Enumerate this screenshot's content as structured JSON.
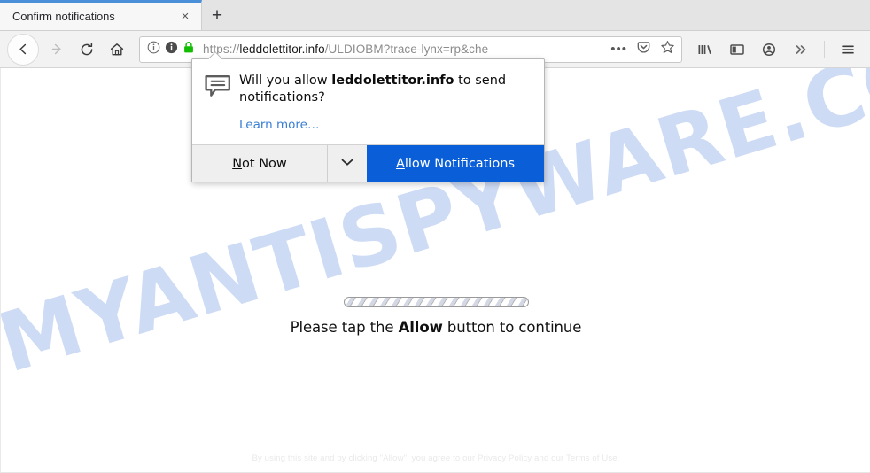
{
  "browser": {
    "tab": {
      "title": "Confirm notifications",
      "close_label": "×",
      "new_tab_label": "+"
    },
    "nav": {
      "back_label": "Back",
      "forward_label": "Forward",
      "reload_label": "Reload",
      "home_label": "Home"
    },
    "urlbar": {
      "scheme": "https://",
      "host": "leddolettitor.info",
      "path": "/ULDIOBM?trace-lynx=rp&che",
      "full_url": "https://leddolettitor.info/ULDIOBM?trace-lynx=rp&che",
      "page_action_label": "•••"
    },
    "toolbar_icons": [
      "library-icon",
      "sidebar-icon",
      "account-icon",
      "overflow-icon",
      "menu-icon"
    ]
  },
  "popup": {
    "icon": "notification-bubble-icon",
    "message_prefix": "Will you allow ",
    "message_host": "leddolettitor.info",
    "message_suffix": " to send notifications?",
    "learn_more": "Learn more…",
    "not_now_first": "N",
    "not_now_rest": "ot Now",
    "dropdown_icon": "chevron-down-icon",
    "allow_first": "A",
    "allow_rest": "llow Notifications",
    "accent_color": "#0a5fd8"
  },
  "page": {
    "watermark": "MYANTISPYWARE.COM",
    "watermark_color": "#cbdaf5",
    "tap_prefix": "Please tap the ",
    "tap_bold": "Allow",
    "tap_suffix": " button to continue",
    "footer": "By using this site and by clicking \"Allow\", you agree to our Privacy Policy and our Terms of Use."
  }
}
